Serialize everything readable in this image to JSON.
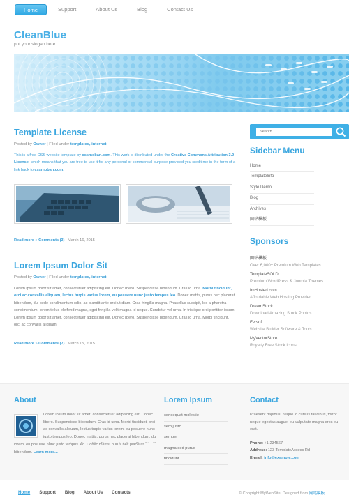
{
  "nav": {
    "items": [
      {
        "label": "Home",
        "active": true
      },
      {
        "label": "Support",
        "active": false
      },
      {
        "label": "About Us",
        "active": false
      },
      {
        "label": "Blog",
        "active": false
      },
      {
        "label": "Contact Us",
        "active": false
      }
    ]
  },
  "logo": {
    "title": "CleanBlue",
    "slogan": "put your slogan here"
  },
  "posts": [
    {
      "title": "Template License",
      "meta_prefix": "Posted by",
      "author": "Owner",
      "meta_mid": "| Filed under",
      "category": "templates, internet",
      "text_1": "This is a free CSS website template by",
      "link_1": "cssmoban.com",
      "text_2": ". This work is distributed under the",
      "link_2": "Creative Commons Attribution 3.0 License",
      "text_3": ", which means that you are free to use it for any personal or commercial purpose provided you credit me in the form of a link back to",
      "link_3": "cssmoban.com",
      "text_4": ".",
      "read_more": "Read more",
      "comments": "Comments (3)",
      "date": "| March 16, 2015"
    },
    {
      "title": "Lorem Ipsum Dolor Sit",
      "meta_prefix": "Posted by",
      "author": "Owner",
      "meta_mid": "| Filed under",
      "category": "templates, internet",
      "text_1": "Lorem ipsum dolor sit amet, consectetuer adipiscing elit. Donec libero. Suspendisse bibendum. Cras id urna.",
      "link_1": "Morbi tincidunt, orci ac convallis aliquam, lectus turpis varius lorem, eu posuere nunc justo tempus leo.",
      "text_2": "Donec mattis, purus nec placerat bibendum, dui pede condimentum odio, ac blandit ante orci ut diam. Cras fringilla magna. Phasellus suscipit, leo a pharetra condimentum, lorem tellus eleifend magna, eget fringilla velit magna id neque. Curabitur vel urna. In tristique orci porttitor ipsum. Lorem ipsum dolor sit amet, consectetuer adipiscing elit. Donec libero. Suspendisse bibendum. Cras id urna. Morbi tincidunt, orci ac convallis aliquam.",
      "read_more": "Read more",
      "comments": "Comments (7)",
      "date": "| March 15, 2015"
    }
  ],
  "search": {
    "placeholder": "Search"
  },
  "sidebar_menu": {
    "title": "Sidebar Menu",
    "items": [
      "Home",
      "TemplateInfo",
      "Style Demo",
      "Blog",
      "Archives",
      "网站模板"
    ]
  },
  "sponsors": {
    "title": "Sponsors",
    "items": [
      {
        "name": "网站模板",
        "desc": "Over 6,000+ Premium Web Templates"
      },
      {
        "name": "TemplateSOLD",
        "desc": "Premium WordPress & Joomla Themes"
      },
      {
        "name": "ImHosted.com",
        "desc": "Affordable Web Hosting Provider"
      },
      {
        "name": "DreamStock",
        "desc": "Download Amazing Stock Photos"
      },
      {
        "name": "Evrsoft",
        "desc": "Website Builder Software & Tools"
      },
      {
        "name": "MyVectorStore",
        "desc": "Royalty Free Stock Icons"
      }
    ]
  },
  "about": {
    "title": "About",
    "text": "Lorem ipsum dolor sit amet, consectetuer adipiscing elit. Donec libero. Suspendisse bibendum. Cras id urna. Morbi tincidunt, orci ac convallis aliquam, lectus turpis varius lorem, eu posuere nunc justo tempus leo. Donec mattis, purus nec placerat bibendum, dui pede condimentum odio, ac blandit ante orci ut diam. Cras fringilla magna.",
    "text_visible": "Lorem ipsum dolor sit amet, consectetuer adipiscing elit. Donec libero. Suspendisse bibendum. Cras id urna. Morbi tincidunt, orci ac convallis aliquam, lectus turpis varius lorem, eu posuere nunc justo tempus leo. Donec mattis, purus nec placerat bibendum.",
    "read_more": "Learn more..."
  },
  "lorem_list": {
    "title": "Lorem Ipsum",
    "items": [
      "consequat molestie",
      "sem justo",
      "semper",
      "magna sed purus",
      "tincidunt"
    ]
  },
  "contact": {
    "title": "Contact",
    "text": "Praesent dapibus, neque id cursus faucibus, tortor neque egestas augue, eu vulputate magna eros eu erat.",
    "phone_label": "Phone:",
    "phone": "+1 234567",
    "address_label": "Address:",
    "address": "123 TemplateAccess Rd",
    "email_label": "E-mail:",
    "email": "info@example.com"
  },
  "footer_nav": [
    {
      "label": "Home",
      "active": true
    },
    {
      "label": "Support",
      "active": false
    },
    {
      "label": "Blog",
      "active": false
    },
    {
      "label": "About Us",
      "active": false
    },
    {
      "label": "Contacts",
      "active": false
    }
  ],
  "copyright": {
    "text": "© Copyright MyWebSite. Designed from",
    "link": "网站模板"
  }
}
